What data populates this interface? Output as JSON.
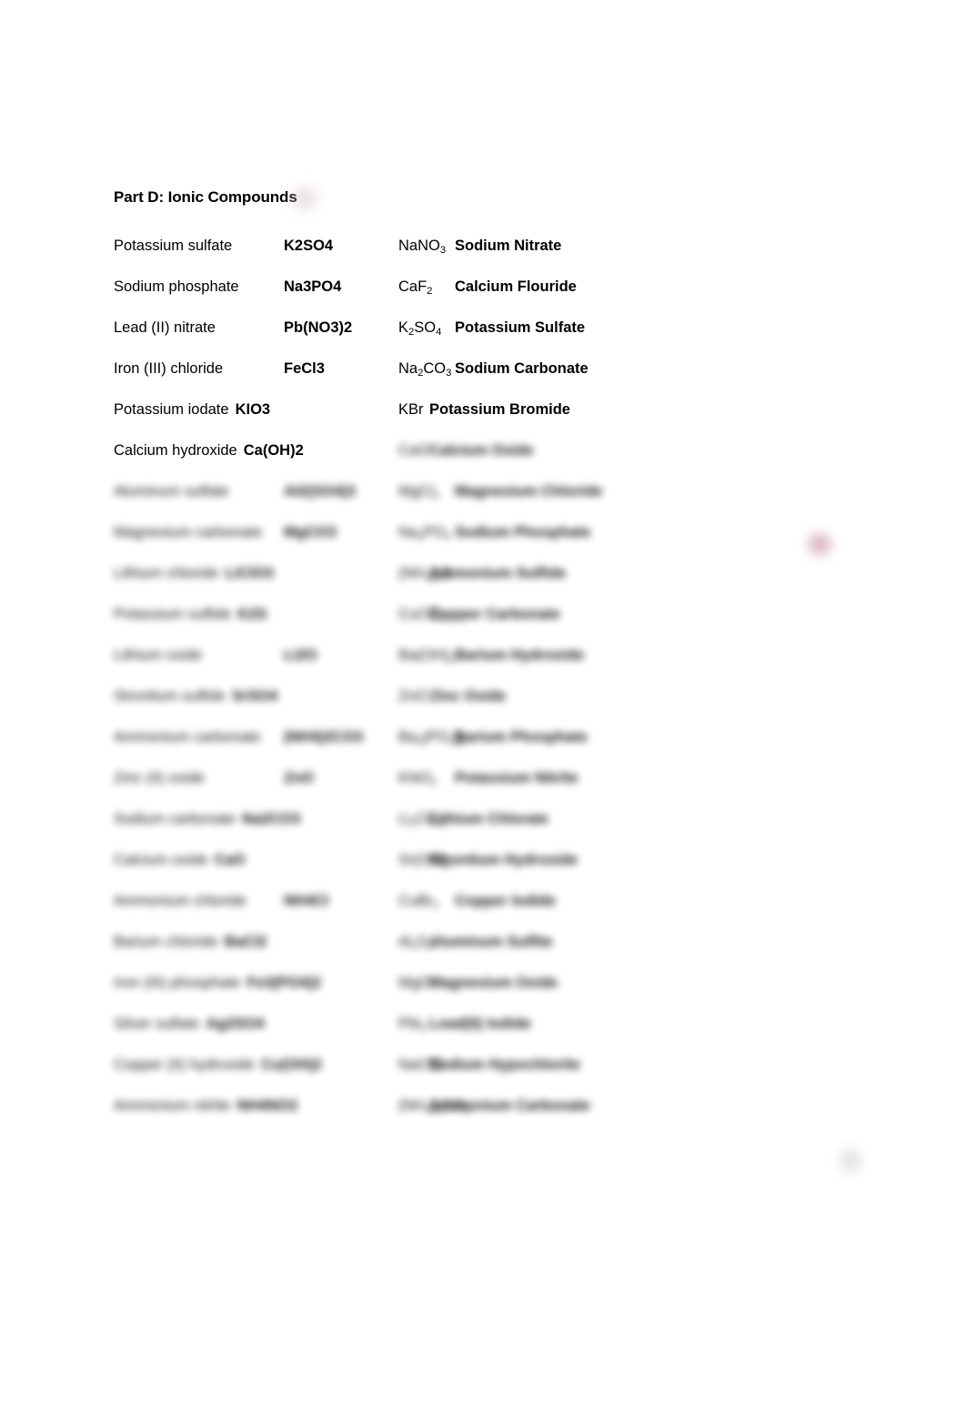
{
  "document": {
    "section_heading": "Part D: Ionic Compounds",
    "rows": [
      {
        "layout": "tabbed",
        "left_name": "Potassium sulfate",
        "left_formula": "K2SO4",
        "right_formula_html": "NaNO<sub>3</sub>",
        "right_name": "Sodium Nitrate",
        "blurred": false
      },
      {
        "layout": "tabbed",
        "left_name": "Sodium phosphate",
        "left_formula": "Na3PO4",
        "right_formula_html": "CaF<sub>2</sub>",
        "right_name": "Calcium Flouride",
        "blurred": false
      },
      {
        "layout": "tabbed",
        "left_name": "Lead (II) nitrate",
        "left_formula": "Pb(NO3)2",
        "right_formula_html": "K<sub>2</sub>SO<sub>4</sub>",
        "right_name": "Potassium Sulfate",
        "blurred": false
      },
      {
        "layout": "tabbed",
        "left_name": "Iron (III) chloride",
        "left_formula": "FeCl3",
        "right_formula_html": "Na<sub>2</sub>CO<sub>3</sub>",
        "right_name": "Sodium Carbonate",
        "blurred": false
      },
      {
        "layout": "inline",
        "left_name": "Potassium iodate",
        "left_formula": "KIO3",
        "right_formula_html": "KBr",
        "right_name": "Potassium Bromide",
        "blurred": false
      },
      {
        "layout": "inline",
        "left_name": "Calcium hydroxide",
        "left_formula": "Ca(OH)2",
        "right_formula_html": "CaO",
        "right_name": "Calcium Oxide",
        "blurred": false,
        "right_blurred": true
      },
      {
        "layout": "tabbed",
        "left_name": "Aluminum sulfate",
        "left_formula": "Al2(SO4)3",
        "right_formula_html": "MgCl<sub>2</sub>",
        "right_name": "Magnesium Chloride",
        "blurred": true
      },
      {
        "layout": "tabbed",
        "left_name": "Magnesium carbonate",
        "left_formula": "MgCO3",
        "right_formula_html": "Na<sub>3</sub>PO<sub>4</sub>",
        "right_name": "Sodium Phosphate",
        "blurred": true
      },
      {
        "layout": "inline",
        "left_name": "Lithium chloride",
        "left_formula": "LiClO3",
        "right_formula_html": "(NH<sub>4</sub>)<sub>2</sub>S",
        "right_name": "Ammonium Sulfide",
        "blurred": true
      },
      {
        "layout": "inline",
        "left_name": "Potassium sulfide",
        "left_formula": "K2S",
        "right_formula_html": "CuCO<sub>3</sub>",
        "right_name": "Copper Carbonate",
        "blurred": true
      },
      {
        "layout": "tabbed",
        "left_name": "Lithium oxide",
        "left_formula": "Li2O",
        "right_formula_html": "Ba(OH)<sub>2</sub>",
        "right_name": "Barium Hydroxide",
        "blurred": true
      },
      {
        "layout": "inline",
        "left_name": "Strontium sulfide",
        "left_formula": "SrSO4",
        "right_formula_html": "ZnO",
        "right_name": "Zinc Oxide",
        "blurred": true
      },
      {
        "layout": "tabbed",
        "left_name": "Ammonium carbonate",
        "left_formula": "(NH4)2CO3",
        "right_formula_html": "Ba<sub>3</sub>(PO<sub>4</sub>)<sub>2</sub>",
        "right_name": "Barium Phosphate",
        "blurred": true
      },
      {
        "layout": "tabbed",
        "left_name": "Zinc (II) oxide",
        "left_formula": "ZnO",
        "right_formula_html": "KNO<sub>2</sub>",
        "right_name": "Potassium Nitrite",
        "blurred": true
      },
      {
        "layout": "inline",
        "left_name": "Sodium carbonate",
        "left_formula": "Na2CO3",
        "right_formula_html": "Li<sub>2</sub>CO<sub>3</sub>",
        "right_name": "Lithium Chlorate",
        "blurred": true
      },
      {
        "layout": "inline",
        "left_name": "Calcium oxide",
        "left_formula": "CaO",
        "right_formula_html": "Sr(OH)<sub>2</sub>",
        "right_name": "Strontium Hydroxide",
        "blurred": true
      },
      {
        "layout": "tabbed",
        "left_name": "Ammonium chloride",
        "left_formula": "NH4Cl",
        "right_formula_html": "CuBr<sub>2</sub>",
        "right_name": "Copper Iodide",
        "blurred": true
      },
      {
        "layout": "inline",
        "left_name": "Barium chloride",
        "left_formula": "BaCl2",
        "right_formula_html": "Al<sub>2</sub>S<sub>3</sub>",
        "right_name": "Aluminum Sulfite",
        "blurred": true
      },
      {
        "layout": "inline",
        "left_name": "Iron (III) phosphate",
        "left_formula": "Fe3(PO4)2",
        "right_formula_html": "MgO",
        "right_name": "Magnesium Oxide",
        "blurred": true
      },
      {
        "layout": "inline",
        "left_name": "Silver sulfate",
        "left_formula": "Ag2SO4",
        "right_formula_html": "PbI<sub>2</sub>",
        "right_name": "Lead(II) Iodide",
        "blurred": true
      },
      {
        "layout": "inline",
        "left_name": "Copper (II) hydroxide",
        "left_formula": "Cu(OH)2",
        "right_formula_html": "NaClO",
        "right_name": "Sodium Hypochlorite",
        "blurred": true
      },
      {
        "layout": "inline",
        "left_name": "Ammonium nitrite",
        "left_formula": "NH4NO2",
        "right_formula_html": "(NH<sub>4</sub>)<sub>2</sub>CO<sub>3</sub>",
        "right_name": "Ammonium Carbonate",
        "blurred": true
      }
    ]
  }
}
